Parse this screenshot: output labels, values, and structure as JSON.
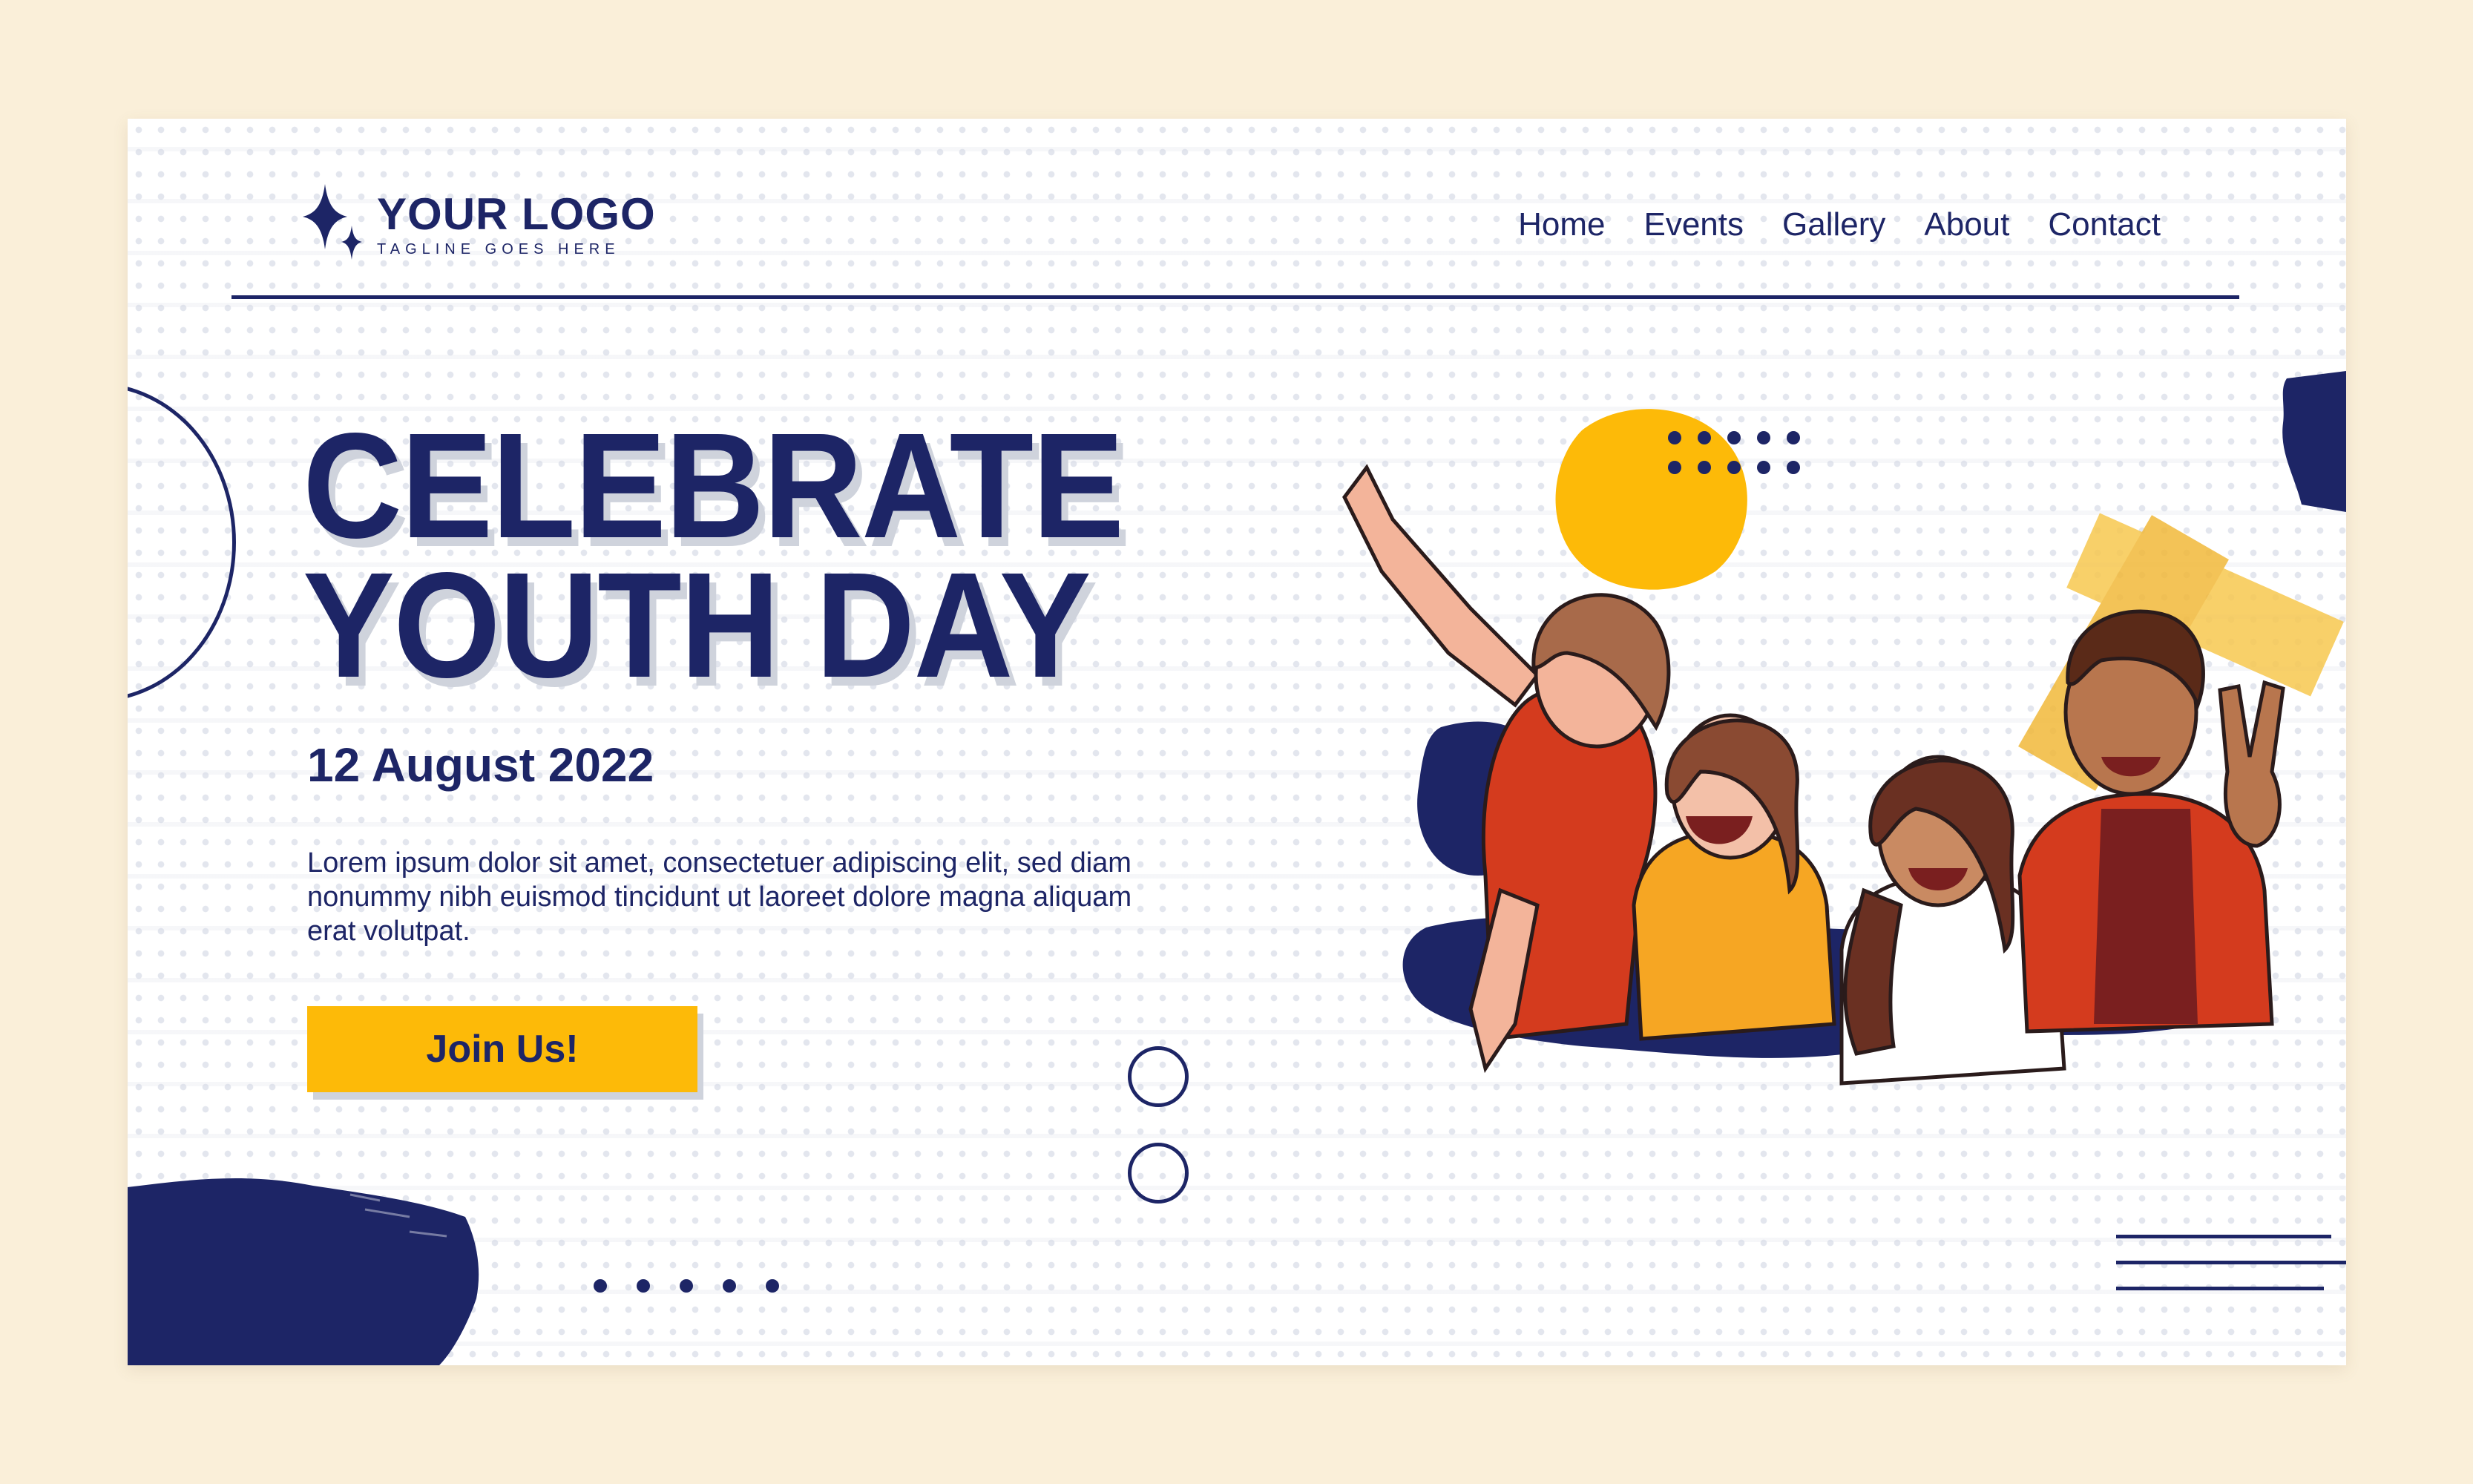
{
  "logo": {
    "name": "YOUR LOGO",
    "tagline": "TAGLINE GOES HERE",
    "icon": "sparkle-star-icon"
  },
  "nav": {
    "items": [
      {
        "label": "Home"
      },
      {
        "label": "Events"
      },
      {
        "label": "Gallery"
      },
      {
        "label": "About"
      },
      {
        "label": "Contact"
      }
    ]
  },
  "hero": {
    "title_line1": "CELEBRATE",
    "title_line2": "YOUTH DAY",
    "date": "12 August 2022",
    "body": "Lorem ipsum dolor sit amet, consectetuer adipiscing elit, sed diam nonummy nibh euismod tincidunt ut laoreet dolore magna aliquam erat volutpat.",
    "cta_label": "Join Us!"
  },
  "colors": {
    "navy": "#1d2566",
    "yellow": "#fdba08",
    "background": "#faefd9"
  }
}
